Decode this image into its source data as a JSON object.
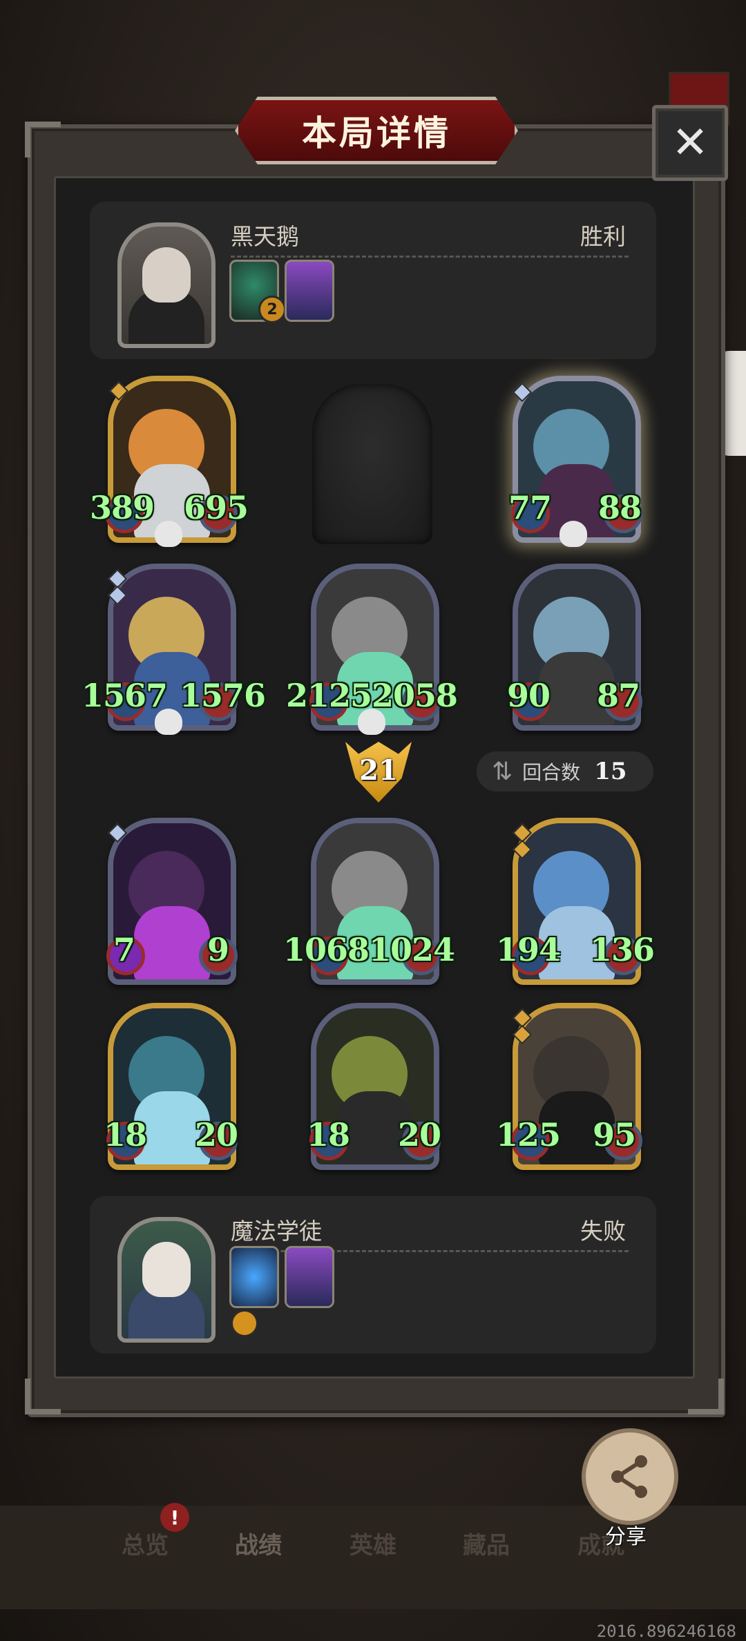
{
  "title": "本局详情",
  "close_icon": "✕",
  "player_top": {
    "name": "黑天鹅",
    "result": "胜利",
    "item_badge": "2"
  },
  "player_bottom": {
    "name": "魔法学徒",
    "result": "失败"
  },
  "top_board": {
    "row1": [
      {
        "atk": "389",
        "hp": "695",
        "frame": "gold",
        "colors": [
          "#d98a3a",
          "#cfd3d6"
        ]
      },
      {
        "empty": true
      },
      {
        "atk": "77",
        "hp": "88",
        "frame": "glow",
        "colors": [
          "#5c8fa8",
          "#2a1a2a"
        ]
      }
    ],
    "row2": [
      {
        "atk": "1567",
        "hp": "1576",
        "frame": "blue",
        "colors": [
          "#c9a85a",
          "#3d5f9a"
        ]
      },
      {
        "atk": "2125",
        "hp": "2058",
        "frame": "blue",
        "colors": [
          "#8a8a8a",
          "#6fd6b0"
        ]
      },
      {
        "atk": "90",
        "hp": "87",
        "frame": "blue",
        "colors": [
          "#7aa0b8",
          "#3a3a3a"
        ]
      }
    ]
  },
  "damage": "21",
  "rounds": {
    "icon": "repeat-icon",
    "label": "回合数",
    "value": "15"
  },
  "bottom_board": {
    "row1": [
      {
        "atk": "7",
        "hp": "9",
        "frame": "blue",
        "colors": [
          "#4a2a5a",
          "#b040d0"
        ]
      },
      {
        "atk": "1068",
        "hp": "1024",
        "frame": "blue",
        "colors": [
          "#8a8a8a",
          "#6fd6b0"
        ]
      },
      {
        "atk": "194",
        "hp": "136",
        "frame": "gold",
        "colors": [
          "#5b8fc7",
          "#9fc2e0"
        ]
      }
    ],
    "row2": [
      {
        "atk": "18",
        "hp": "20",
        "frame": "gold",
        "colors": [
          "#3a7a8a",
          "#9ad7e8"
        ]
      },
      {
        "atk": "18",
        "hp": "20",
        "frame": "blue",
        "colors": [
          "#7a8a3a",
          "#2a2a2a"
        ]
      },
      {
        "atk": "125",
        "hp": "95",
        "frame": "gold",
        "colors": [
          "#3a3530",
          "#1a1a1a"
        ]
      }
    ]
  },
  "nav": {
    "tabs": [
      "总览",
      "战绩",
      "英雄",
      "藏品",
      "成就"
    ],
    "active": "战绩",
    "alert": "!"
  },
  "share_label": "分享",
  "version": "2016.896246168",
  "accent": "#a8ff9a"
}
